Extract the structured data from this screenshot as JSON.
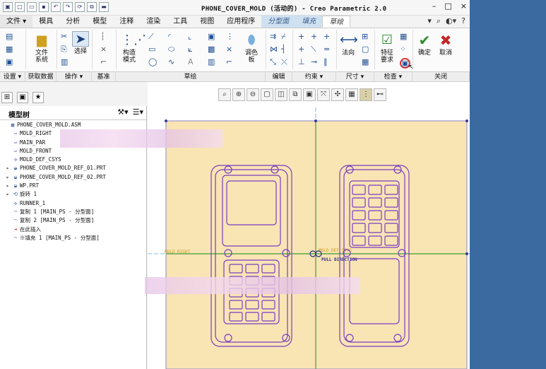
{
  "window": {
    "title": "PHONE_COVER_MOLD (活动的) - Creo Parametric 2.0",
    "controls": [
      "–",
      "□",
      "×"
    ]
  },
  "menu_tabs": [
    {
      "label": "文件 ▾",
      "style": "file"
    },
    {
      "label": "模具",
      "style": ""
    },
    {
      "label": "分析",
      "style": ""
    },
    {
      "label": "模型",
      "style": ""
    },
    {
      "label": "注释",
      "style": ""
    },
    {
      "label": "渲染",
      "style": ""
    },
    {
      "label": "工具",
      "style": ""
    },
    {
      "label": "视图",
      "style": ""
    },
    {
      "label": "应用程序",
      "style": ""
    },
    {
      "label": "分型面",
      "style": "mode"
    },
    {
      "label": "填充",
      "style": "mode"
    },
    {
      "label": "草绘",
      "style": "active"
    }
  ],
  "ribbon": {
    "file_system_label": "文件\n系统",
    "select_label": "选择",
    "construct_mode_label": "构造\n模式",
    "palette_label": "调色\n板",
    "normal_label": "法向",
    "feature_req_label": "特征\n要求",
    "ok_label": "确定",
    "cancel_label": "取消"
  },
  "groups": [
    {
      "label": "设置 ▾",
      "w": 36
    },
    {
      "label": "获取数据",
      "w": 44
    },
    {
      "label": "操作 ▾",
      "w": 50
    },
    {
      "label": "基准",
      "w": 34
    },
    {
      "label": "草绘",
      "w": 218
    },
    {
      "label": "编辑",
      "w": 36
    },
    {
      "label": "约束 ▾",
      "w": 62
    },
    {
      "label": "尺寸 ▾",
      "w": 56
    },
    {
      "label": "检查 ▾",
      "w": 50
    },
    {
      "label": "关闭",
      "w": 79
    }
  ],
  "model_tree": {
    "header": "模型树",
    "items": [
      {
        "text": "PHONE_COVER_MOLD.ASM",
        "icon": "▦",
        "exp": "",
        "indent": 0
      },
      {
        "text": "MOLD_RIGHT",
        "icon": "▱",
        "exp": "",
        "indent": 1
      },
      {
        "text": "MAIN_PAR",
        "icon": "▱",
        "exp": "",
        "indent": 1
      },
      {
        "text": "MOLD_FRONT",
        "icon": "▱",
        "exp": "",
        "indent": 1
      },
      {
        "text": "MOLD_DEF_CSYS",
        "icon": "✣",
        "exp": "",
        "indent": 1
      },
      {
        "text": "PHONE_COVER_MOLD_REF_01.PRT",
        "icon": "◒",
        "exp": "▸",
        "indent": 1
      },
      {
        "text": "PHONE_COVER_MOLD_REF_02.PRT",
        "icon": "◒",
        "exp": "▸",
        "indent": 1
      },
      {
        "text": "WP.PRT",
        "icon": "◒",
        "exp": "▸",
        "indent": 1
      },
      {
        "text": "旋转 1",
        "icon": "⟲",
        "exp": "▸",
        "indent": 1
      },
      {
        "text": "RUNNER_1",
        "icon": "✣",
        "exp": "",
        "indent": 1
      },
      {
        "text": "复制 1 [MAIN_PS - 分型面]",
        "icon": "◠",
        "exp": "",
        "indent": 1
      },
      {
        "text": "复制 2 [MAIN_PS - 分型面]",
        "icon": "◠",
        "exp": "",
        "indent": 1
      },
      {
        "text": "在此插入",
        "icon": "➜",
        "exp": "",
        "indent": 1
      },
      {
        "text": "※填充 1 [MAIN_PS - 分型面]",
        "icon": "◠",
        "exp": "",
        "indent": 1
      }
    ]
  },
  "graphics": {
    "label_mold_right": "MOLD_RIGHT",
    "label_mold_def_csys": "MOLD_DEF_CSYS",
    "label_pull_direction": "PULL DIRECTION"
  },
  "colors": {
    "sketch_bg": "#f9e4b4",
    "sketch_border": "#8a8ac8",
    "phone_outline": "#7a3fc0",
    "datum_line": "#5aa848",
    "datum_label": "#c8a020",
    "ok_green": "#2e8b2e",
    "cancel_red": "#c0282a"
  }
}
